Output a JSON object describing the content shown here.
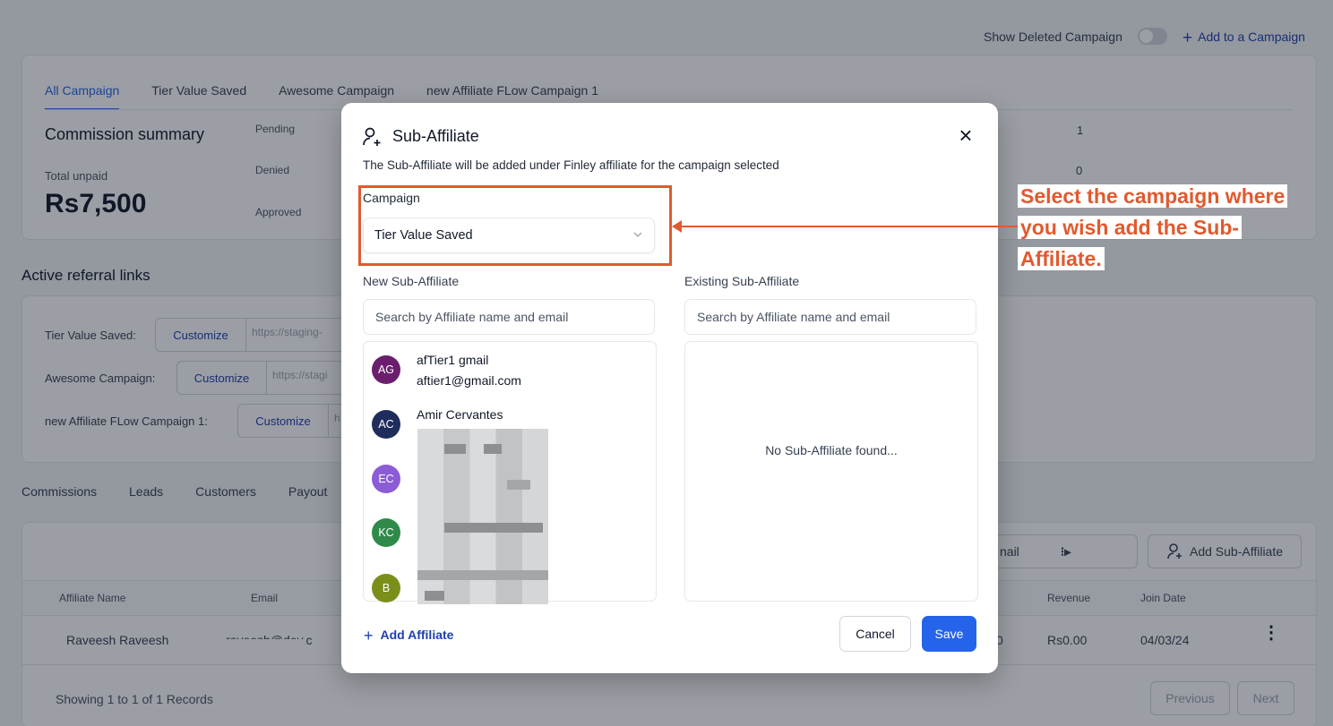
{
  "topbar": {
    "show_deleted_label": "Show Deleted Campaign",
    "add_campaign_label": "Add to a Campaign"
  },
  "campaign_tabs": [
    "All Campaign",
    "Tier Value Saved",
    "Awesome Campaign",
    "new Affiliate FLow Campaign 1"
  ],
  "summary": {
    "title": "Commission summary",
    "total_label": "Total unpaid",
    "total_value": "Rs7,500",
    "stats": [
      {
        "label": "Pending",
        "value": "1"
      },
      {
        "label": "Denied",
        "value": "0"
      },
      {
        "label": "Approved",
        "value": ""
      }
    ]
  },
  "referral_links": {
    "title": "Active referral links",
    "items": [
      {
        "label": "Tier Value Saved:",
        "button": "Customize",
        "url": "https://staging-"
      },
      {
        "label": "Awesome Campaign:",
        "button": "Customize",
        "url": "https://stagi"
      },
      {
        "label": "new Affiliate FLow Campaign 1:",
        "button": "Customize",
        "url": "h"
      }
    ]
  },
  "bottom_tabs": [
    "Commissions",
    "Leads",
    "Customers",
    "Payout"
  ],
  "table": {
    "search_fragment": "nail",
    "add_sub_affiliate": "Add Sub-Affiliate",
    "headers": [
      "Affiliate Name",
      "Email",
      "Revenue",
      "Join Date"
    ],
    "rows": [
      {
        "name": "Raveesh Raveesh",
        "email": "raveesh@dev.c",
        "revenue_prefix": "0",
        "revenue": "Rs0.00",
        "join_date": "04/03/24"
      }
    ],
    "footer": "Showing 1 to 1 of 1 Records",
    "prev": "Previous",
    "next": "Next"
  },
  "modal": {
    "title": "Sub-Affiliate",
    "description": "The Sub-Affiliate will be added under Finley affiliate for the campaign selected",
    "campaign_label": "Campaign",
    "campaign_value": "Tier Value Saved",
    "new_label": "New Sub-Affiliate",
    "existing_label": "Existing Sub-Affiliate",
    "new_search_placeholder": "Search by Affiliate name and email",
    "existing_search_placeholder": "Search by Affiliate name and email",
    "affiliates": [
      {
        "initials": "AG",
        "color": "#6b1e6e",
        "name": "afTier1 gmail",
        "email": "aftier1@gmail.com"
      },
      {
        "initials": "AC",
        "color": "#1f2d5c",
        "name": "Amir Cervantes",
        "email": ""
      },
      {
        "initials": "EC",
        "color": "#8b5cd6",
        "name": "",
        "email": ""
      },
      {
        "initials": "KC",
        "color": "#2f8a4a",
        "name": "",
        "email": ""
      },
      {
        "initials": "B",
        "color": "#7a8f1a",
        "name": "",
        "email": ""
      }
    ],
    "empty_message": "No Sub-Affiliate found...",
    "add_affiliate": "Add Affiliate",
    "cancel": "Cancel",
    "save": "Save"
  },
  "annotation": {
    "lines": [
      "Select the campaign where",
      "you wish add the Sub-",
      "Affiliate."
    ],
    "color": "#e05a2f"
  }
}
